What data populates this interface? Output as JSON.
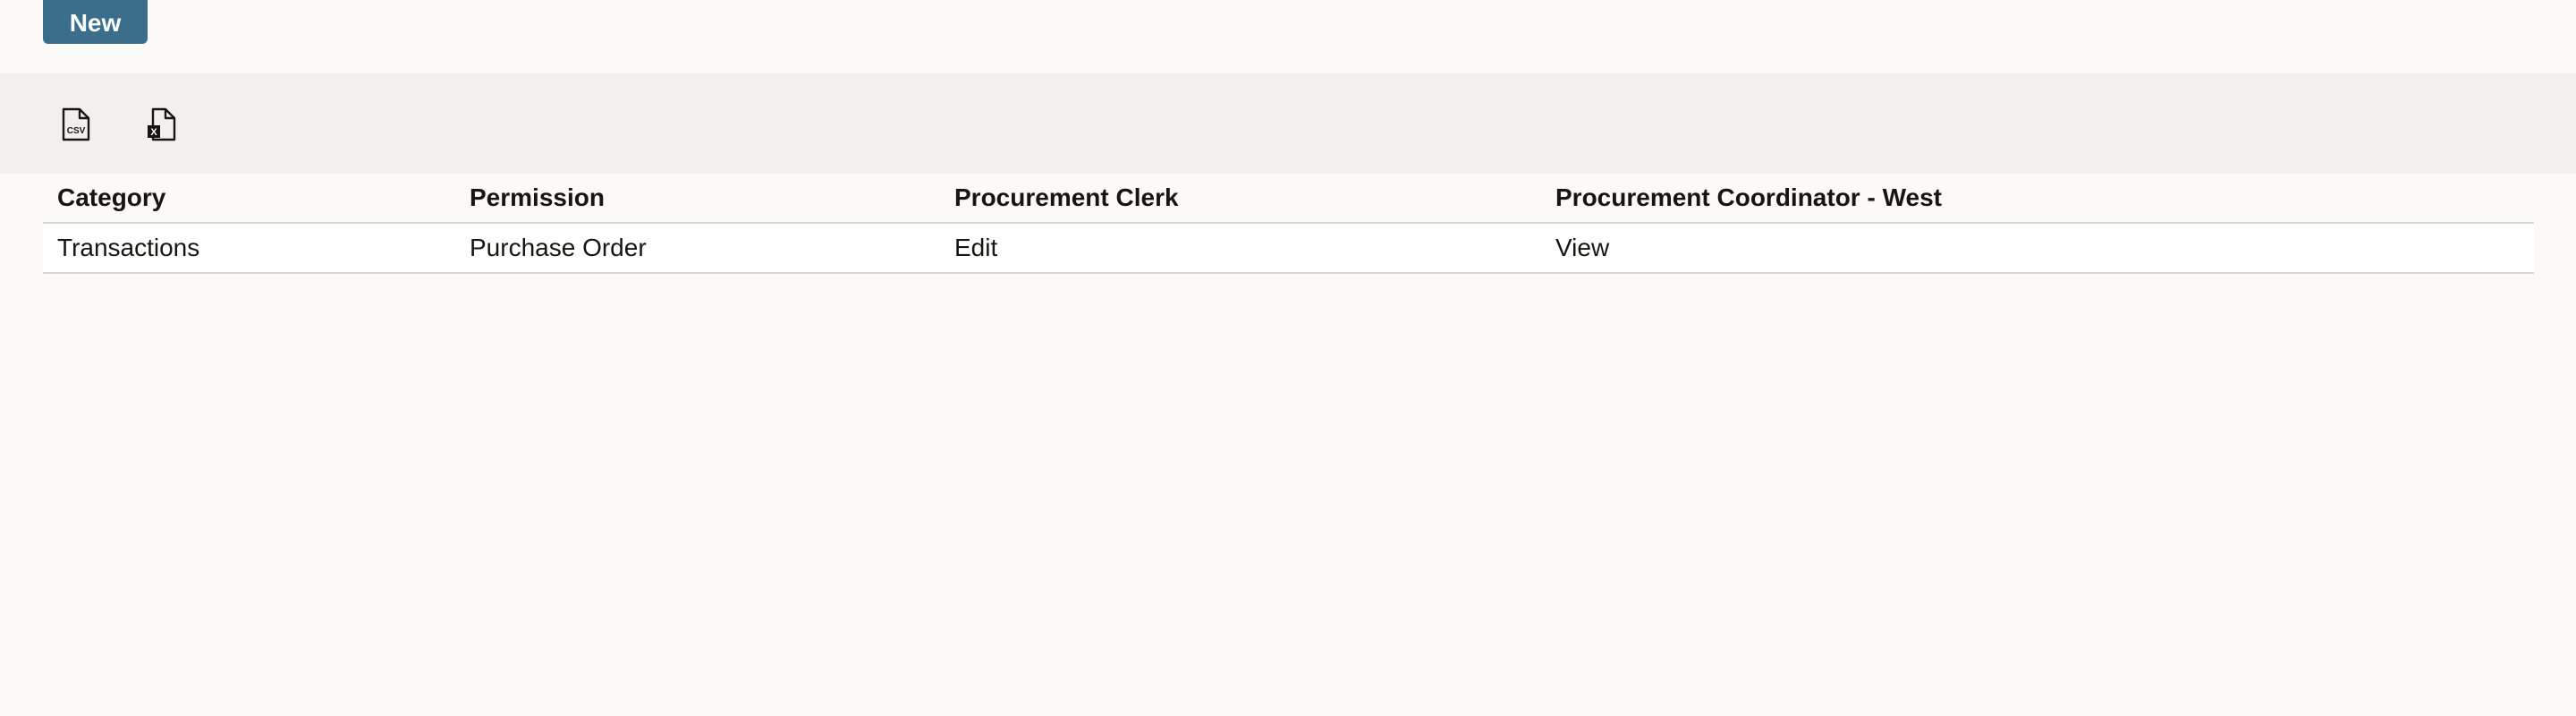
{
  "actions": {
    "new_label": "New"
  },
  "toolbar": {
    "export_csv_icon": "csv-file-icon",
    "export_xls_icon": "excel-file-icon",
    "csv_glyph_text": "CSV",
    "xls_glyph_text": "X"
  },
  "table": {
    "columns": [
      "Category",
      "Permission",
      "Procurement Clerk",
      "Procurement Coordinator - West"
    ],
    "rows": [
      [
        "Transactions",
        "Purchase Order",
        "Edit",
        "View"
      ]
    ]
  },
  "colors": {
    "primary_button": "#3a6e8a",
    "toolbar_bg": "#f1f0ee",
    "page_bg": "#fbfaf8",
    "row_border": "#d8d6d2"
  }
}
